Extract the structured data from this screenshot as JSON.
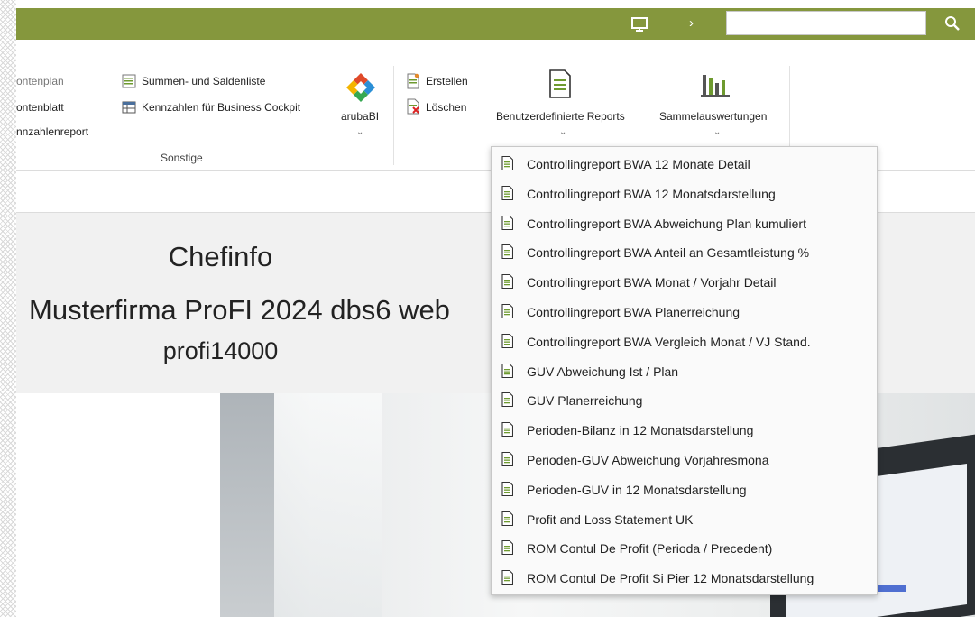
{
  "search": {
    "placeholder": ""
  },
  "ribbon": {
    "col1": [
      "ontenplan",
      "ontenblatt",
      "nnzahlenreport"
    ],
    "col2": [
      "Summen- und Saldenliste",
      "Kennzahlen für Business Cockpit"
    ],
    "group_label": "Sonstige",
    "arubabi_label": "arubaBI",
    "create_label": "Erstellen",
    "delete_label": "Löschen",
    "custom_reports_label": "Benutzerdefinierte Reports",
    "batch_label": "Sammelauswertungen"
  },
  "main": {
    "title": "Chefinfo",
    "company": "Musterfirma ProFI 2024 dbs6 web",
    "company_prefix": "-",
    "user": "profi14000"
  },
  "dropdown": {
    "items": [
      "Controllingreport BWA 12 Monate Detail",
      "Controllingreport BWA 12 Monatsdarstellung",
      "Controllingreport BWA Abweichung Plan kumuliert",
      "Controllingreport BWA Anteil an Gesamtleistung %",
      "Controllingreport BWA Monat / Vorjahr Detail",
      "Controllingreport BWA Planerreichung",
      "Controllingreport BWA Vergleich Monat / VJ Stand.",
      "GUV Abweichung Ist / Plan",
      "GUV Planerreichung",
      "Perioden-Bilanz in 12 Monatsdarstellung",
      "Perioden-GUV Abweichung Vorjahresmona",
      "Perioden-GUV in 12 Monatsdarstellung",
      "Profit and Loss Statement UK",
      "ROM Contul De Profit (Perioda / Precedent)",
      "ROM Contul De Profit Si Pier 12 Monatsdarstellung"
    ]
  },
  "colors": {
    "topbar": "#85973d",
    "accent_green": "#6e9a2f"
  }
}
